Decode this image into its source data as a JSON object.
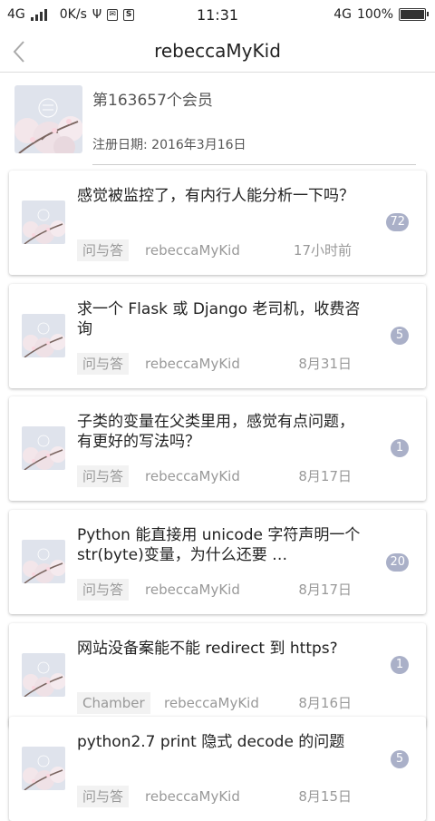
{
  "status_bar": {
    "network_left": "4G",
    "speed": "0K/s",
    "time": "11:31",
    "network_right": "4G",
    "battery": "100%",
    "battery_level": 1.0
  },
  "nav": {
    "title": "rebeccaMyKid",
    "back_icon": "chevron-left-icon"
  },
  "profile": {
    "member_text": "第163657个会员",
    "reg_date": "注册日期: 2016年3月16日",
    "avatar_icon": "spring-blossom-avatar"
  },
  "topics": [
    {
      "title": "感觉被监控了，有内行人能分析一下吗？",
      "tag": "问与答",
      "author": "rebeccaMyKid",
      "time": "17小时前",
      "replies": "72"
    },
    {
      "title": "求一个 Flask 或 Django 老司机，收费咨询",
      "tag": "问与答",
      "author": "rebeccaMyKid",
      "time": "8月31日",
      "replies": "5"
    },
    {
      "title": "子类的变量在父类里用，感觉有点问题，有更好的写法吗？",
      "tag": "问与答",
      "author": "rebeccaMyKid",
      "time": "8月17日",
      "replies": "1"
    },
    {
      "title": "Python 能直接用 unicode 字符声明一个 str(byte)变量，为什么还要 …",
      "tag": "问与答",
      "author": "rebeccaMyKid",
      "time": "8月17日",
      "replies": "20"
    },
    {
      "title": "网站没备案能不能 redirect 到 https?",
      "tag": "Chamber",
      "author": "rebeccaMyKid",
      "time": "8月16日",
      "replies": "1"
    },
    {
      "title": "python2.7 print 隐式 decode 的问题",
      "tag": "问与答",
      "author": "rebeccaMyKid",
      "time": "8月15日",
      "replies": "5"
    }
  ]
}
